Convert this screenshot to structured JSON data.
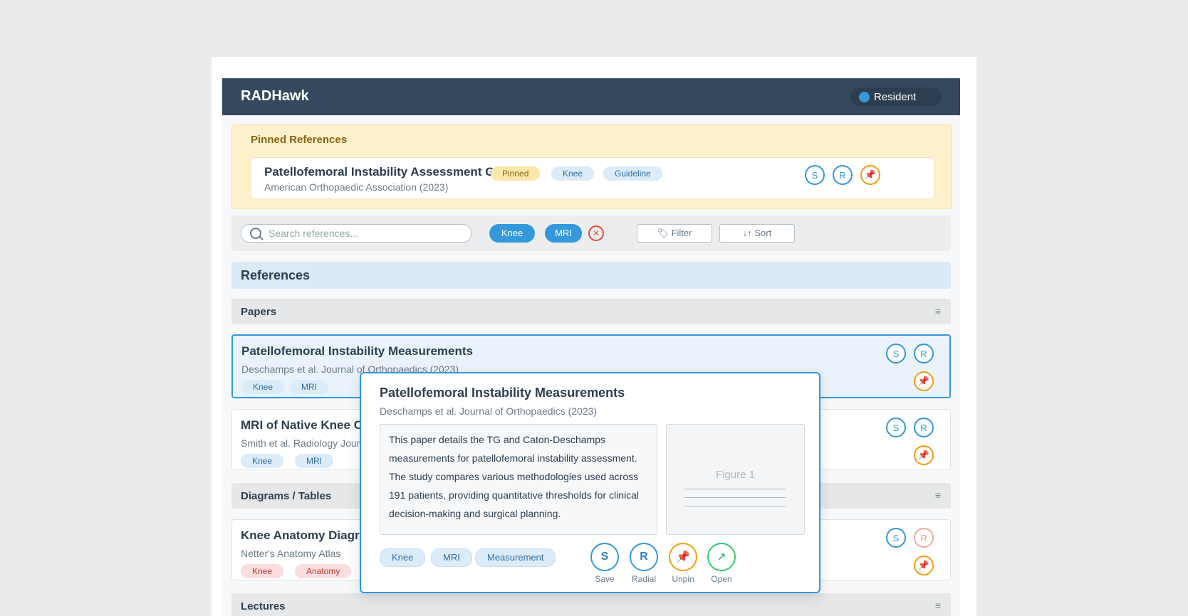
{
  "app": {
    "name": "RADHawk",
    "role": "Resident"
  },
  "pinned": {
    "heading": "Pinned References",
    "item": {
      "title": "Patellofemoral Instability Assessment Guidel",
      "subtitle": "American Orthopaedic Association (2023)",
      "tags": [
        "Pinned",
        "Knee",
        "Guideline"
      ],
      "buttons": {
        "save": "S",
        "radial": "R",
        "unpin": "📌"
      }
    }
  },
  "toolbar": {
    "search_placeholder": "Search references...",
    "chips": [
      "Knee",
      "MRI"
    ],
    "clear": "✕",
    "filter_label": "🏷 Filter",
    "sort_label": "↓↑ Sort"
  },
  "references": {
    "heading": "References",
    "menu_glyph": "≡",
    "sections": {
      "papers": "Papers",
      "diagrams": "Diagrams / Tables",
      "lectures": "Lectures"
    },
    "items": [
      {
        "title": "Patellofemoral Instability Measurements",
        "subtitle": "Deschamps et al. Journal of Orthopaedics (2023)",
        "tags": [
          "Knee",
          "MRI"
        ]
      },
      {
        "title": "MRI of Native Knee C",
        "subtitle": "Smith et al. Radiology Jour",
        "tags": [
          "Knee",
          "MRI"
        ]
      },
      {
        "title": "Knee Anatomy Diagra",
        "subtitle": "Netter's Anatomy Atlas",
        "tags": [
          "Knee",
          "Anatomy"
        ]
      }
    ],
    "row_buttons": {
      "save": "S",
      "radial": "R",
      "pin": "📌"
    }
  },
  "popup": {
    "title": "Patellofemoral Instability Measurements",
    "subtitle": "Deschamps et al. Journal of Orthopaedics (2023)",
    "abstract": "This paper details the TG and Caton-Deschamps measurements for patellofemoral instability assessment. The study compares various methodologies used across 191 patients, providing quantitative thresholds for clinical decision-making and surgical planning.",
    "figure_label": "Figure 1",
    "tags": [
      "Knee",
      "MRI",
      "Measurement"
    ],
    "actions": [
      {
        "glyph": "S",
        "label": "Save"
      },
      {
        "glyph": "R",
        "label": "Radial"
      },
      {
        "glyph": "📌",
        "label": "Unpin"
      },
      {
        "glyph": "↗",
        "label": "Open"
      }
    ]
  },
  "colors": {
    "topbar": "#34495e",
    "accent": "#3498db",
    "pinned_bg": "#fdf1cc",
    "pin_ring": "#f39c12"
  }
}
